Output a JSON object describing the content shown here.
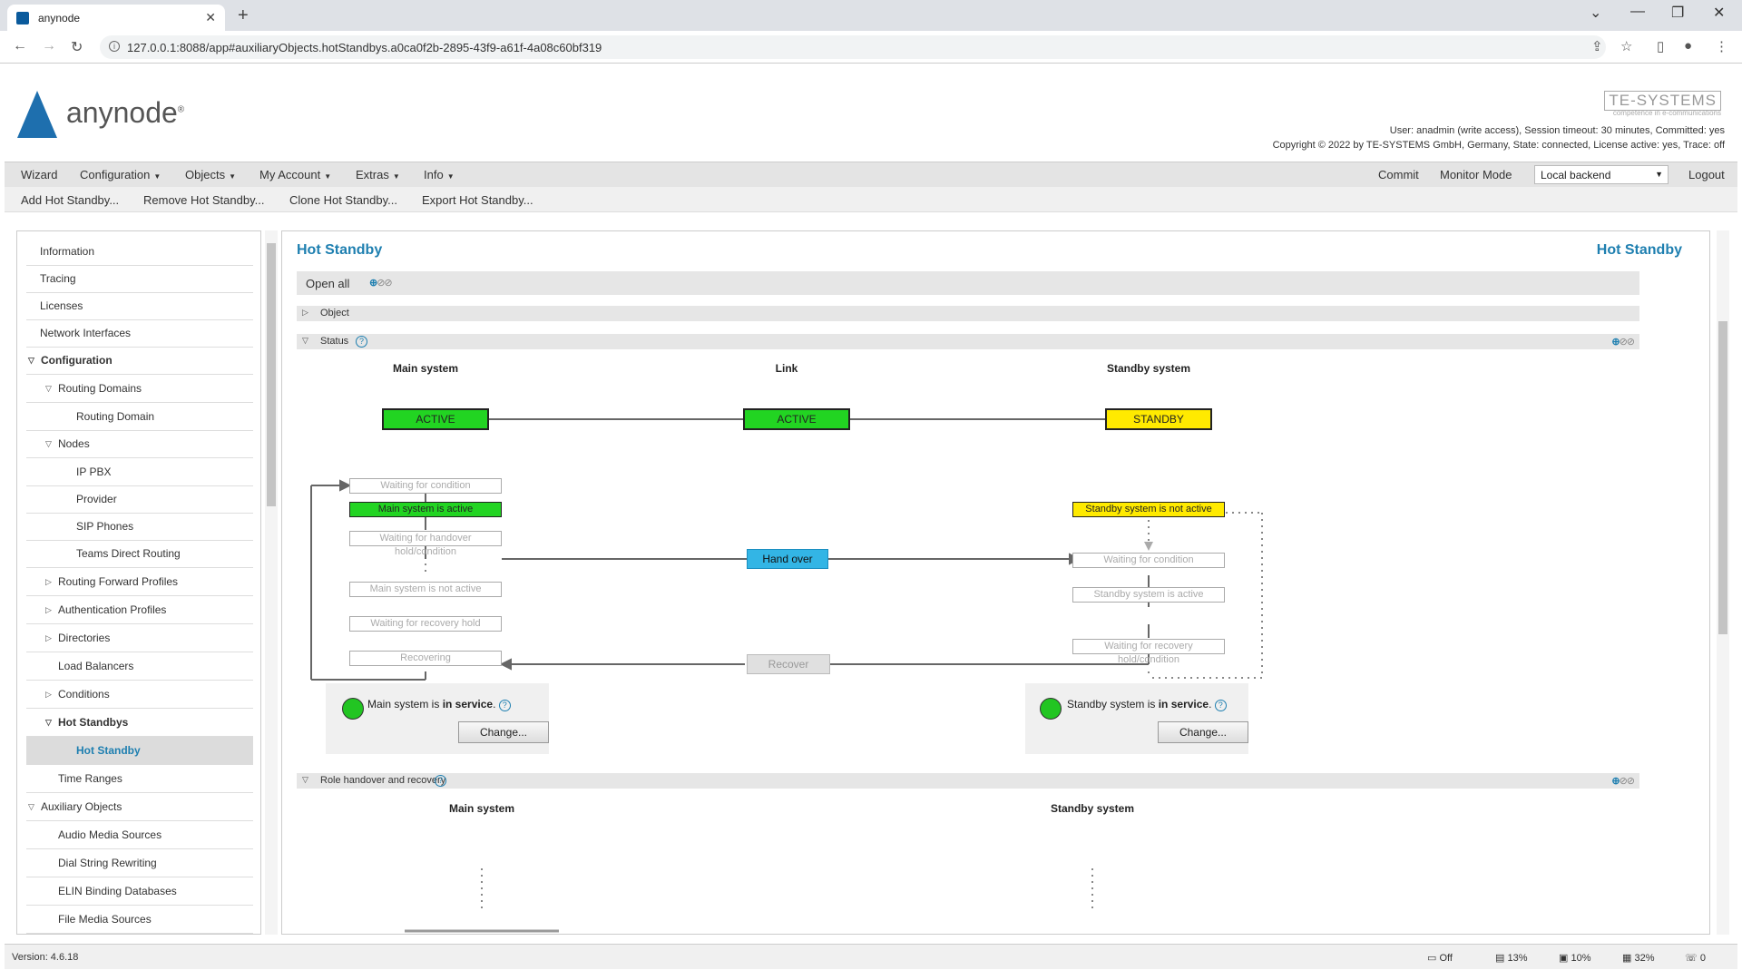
{
  "browser": {
    "tab_title": "anynode",
    "url": "127.0.0.1:8088/app#auxiliaryObjects.hotStandbys.a0ca0f2b-2895-43f9-a61f-4a08c60bf319"
  },
  "header": {
    "logo_text": "anynode",
    "brand": "TE-SYSTEMS",
    "brand_sub": "competence in e-communications",
    "user_line": "User: anadmin (write access), Session timeout: 30 minutes, Committed: yes",
    "copyright_line": "Copyright © 2022 by TE-SYSTEMS GmbH, Germany, State: connected, License active: yes, Trace: off"
  },
  "menu": {
    "items": [
      "Wizard",
      "Configuration",
      "Objects",
      "My Account",
      "Extras",
      "Info"
    ],
    "commit": "Commit",
    "monitor_mode": "Monitor Mode",
    "backend": "Local backend",
    "logout": "Logout"
  },
  "toolbar": [
    "Add Hot Standby...",
    "Remove Hot Standby...",
    "Clone Hot Standby...",
    "Export Hot Standby..."
  ],
  "tree": [
    {
      "label": "Information"
    },
    {
      "label": "Tracing"
    },
    {
      "label": "Licenses"
    },
    {
      "label": "Network Interfaces"
    },
    {
      "label": "Configuration"
    },
    {
      "label": "Routing Domains"
    },
    {
      "label": "Routing Domain"
    },
    {
      "label": "Nodes"
    },
    {
      "label": "IP PBX"
    },
    {
      "label": "Provider"
    },
    {
      "label": "SIP Phones"
    },
    {
      "label": "Teams Direct Routing"
    },
    {
      "label": "Routing Forward Profiles"
    },
    {
      "label": "Authentication Profiles"
    },
    {
      "label": "Directories"
    },
    {
      "label": "Load Balancers"
    },
    {
      "label": "Conditions"
    },
    {
      "label": "Hot Standbys"
    },
    {
      "label": "Hot Standby"
    },
    {
      "label": "Time Ranges"
    },
    {
      "label": "Auxiliary Objects"
    },
    {
      "label": "Audio Media Sources"
    },
    {
      "label": "Dial String Rewriting"
    },
    {
      "label": "ELIN Binding Databases"
    },
    {
      "label": "File Media Sources"
    }
  ],
  "content": {
    "title": "Hot Standby",
    "title_right": "Hot Standby",
    "open_all": "Open all",
    "section_object": "Object",
    "section_status": "Status",
    "section_role": "Role handover and recovery",
    "col_main": "Main system",
    "col_link": "Link",
    "col_standby": "Standby system",
    "main_state": "ACTIVE",
    "link_state": "ACTIVE",
    "standby_state": "STANDBY",
    "flow_main": [
      "Waiting for condition",
      "Main system is active",
      "Waiting for handover hold/condition",
      "Main system is not active",
      "Waiting for recovery hold",
      "Recovering"
    ],
    "flow_standby": [
      "Standby system is not active",
      "Waiting for condition",
      "Standby system is active",
      "Waiting for recovery hold/condition"
    ],
    "hand_over": "Hand over",
    "recover": "Recover",
    "main_service_prefix": "Main system is ",
    "main_service_state": "in service",
    "standby_service_prefix": "Standby system is ",
    "standby_service_state": "in service",
    "change": "Change...",
    "role_main": "Main system",
    "role_standby": "Standby system"
  },
  "statusbar": {
    "version": "Version: 4.6.18",
    "monitor": "Off",
    "disk": "13%",
    "cpu": "10%",
    "mem": "32%",
    "calls": "0"
  },
  "colors": {
    "accent": "#1e7fb0",
    "active": "#22d422",
    "standby": "#ffea00",
    "handover": "#33b5e5"
  }
}
